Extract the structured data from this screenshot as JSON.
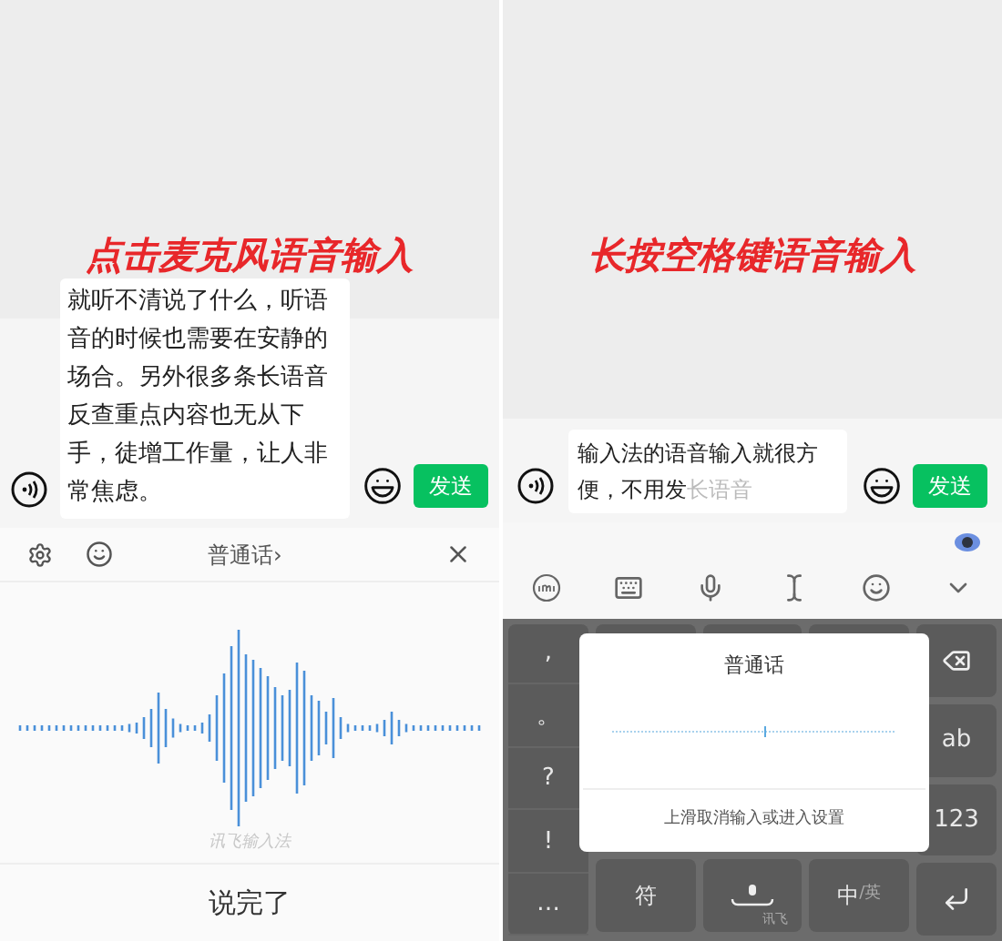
{
  "left_screen": {
    "caption": "点击麦克风语音输入",
    "message": "就听不清说了什么，听语音的时候也需要在安静的场合。另外很多条长语音反查重点内容也无从下手，徒增工作量，让人非常焦虑。",
    "send": "发送",
    "language": "普通话›",
    "brand": "讯飞输入法",
    "done": "说完了"
  },
  "right_screen": {
    "caption": "长按空格键语音输入",
    "message": "输入法的语音输入就很方便，不用发",
    "pending": "长语音",
    "send": "发送",
    "popup": {
      "title": "普通话",
      "hint": "上滑取消输入或进入设置"
    },
    "left_keys": [
      ",",
      "。",
      "?",
      "!",
      "…"
    ],
    "right_keys": [
      {
        "kind": "delete"
      },
      {
        "kind": "text",
        "label": "ab"
      },
      {
        "kind": "text",
        "label": "123"
      },
      {
        "kind": "enter"
      }
    ],
    "bottom_keys": [
      {
        "kind": "text",
        "label": "符"
      },
      {
        "kind": "space",
        "label": "讯飞"
      },
      {
        "kind": "lang",
        "label": "中",
        "sub": "/英"
      }
    ]
  }
}
